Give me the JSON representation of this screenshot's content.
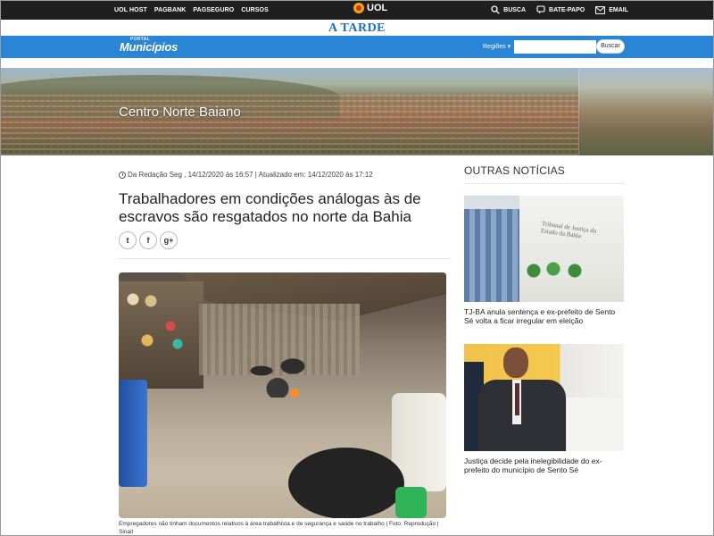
{
  "topbar": {
    "links": [
      "UOL HOST",
      "PAGBANK",
      "PAGSEGURO",
      "CURSOS"
    ],
    "logo": "UOL",
    "right": [
      {
        "label": "BUSCA",
        "icon": "search-icon"
      },
      {
        "label": "BATE-PAPO",
        "icon": "chat-icon"
      },
      {
        "label": "EMAIL",
        "icon": "mail-icon"
      }
    ]
  },
  "masthead": {
    "title": "A TARDE"
  },
  "nav": {
    "brand_small": "PORTAL",
    "brand": "Municípios",
    "regioes": "Regiões",
    "search_placeholder": "",
    "search_button": "Buscar"
  },
  "banner": {
    "region": "Centro Norte Baiano"
  },
  "article": {
    "meta": "Da Redação Seg , 14/12/2020 às 16:57 | Atualizado em: 14/12/2020 às 17:12",
    "headline": "Trabalhadores em condições análogas às de escravos são resgatados no norte da Bahia",
    "social": {
      "twitter": "t",
      "facebook": "f",
      "googleplus": "g+"
    },
    "caption": "Empregadores não tinham documentos relativos à área trabalhista e de segurança e saúde no trabalho | Foto: Reprodução | Sinait"
  },
  "sidebar": {
    "title": "OUTRAS NOTÍCIAS",
    "items": [
      {
        "text": "TJ-BA anula sentença e ex-prefeito de Sento Sé volta a ficar irregular em eleição",
        "image_sign": "Tribunal de Justiça do Estado da Bahia"
      },
      {
        "text": "Justiça decide pela inelegibilidade do ex-prefeito do município de Sento Sé"
      }
    ]
  },
  "colors": {
    "top_bar": "#1f1f1f",
    "nav_blue": "#2b85d6",
    "masthead_blue": "#1b6fc4"
  }
}
